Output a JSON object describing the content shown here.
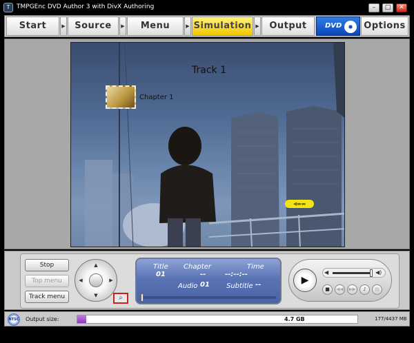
{
  "window": {
    "title": "TMPGEnc DVD Author 3 with DivX Authoring",
    "controls": [
      "minimize",
      "maximize",
      "close"
    ]
  },
  "tabs": [
    {
      "label": "Start",
      "active": false
    },
    {
      "label": "Source",
      "active": false
    },
    {
      "label": "Menu",
      "active": false
    },
    {
      "label": "Simulation",
      "active": true
    },
    {
      "label": "Output",
      "active": false
    },
    {
      "label": "Options",
      "active": false
    }
  ],
  "dvd_logo": {
    "text": "DVD",
    "icon": "dvd-disc-icon"
  },
  "preview": {
    "track_title": "Track 1",
    "chapter_label": "Chapter 1"
  },
  "side_buttons": {
    "stop": "Stop",
    "top_menu": "Top menu",
    "track_menu": "Track menu"
  },
  "info_panel": {
    "title_label": "Title",
    "title_value": "01",
    "chapter_label": "Chapter",
    "chapter_value": "--",
    "time_label": "Time",
    "time_value": "--:--:--",
    "audio_label": "Audio",
    "audio_value": "01",
    "subtitle_label": "Subtitle",
    "subtitle_value": "--"
  },
  "player": {
    "icons": [
      "play-icon",
      "stop-icon",
      "previous-icon",
      "next-icon",
      "audio-icon",
      "subtitle-icon",
      "volume-icon"
    ]
  },
  "status": {
    "format": "NTSC",
    "output_label": "Output size:",
    "output_value": "4.7 GB",
    "size_ratio": "177/4437 MB",
    "used_mb": 177,
    "capacity_mb": 4437
  },
  "colors": {
    "active_tab": "#f0c800",
    "dvd_blue": "#0d45b8",
    "info_panel": "#5a73b5",
    "size_fill": "#8b3cb8",
    "search_highlight": "#c8201a"
  }
}
